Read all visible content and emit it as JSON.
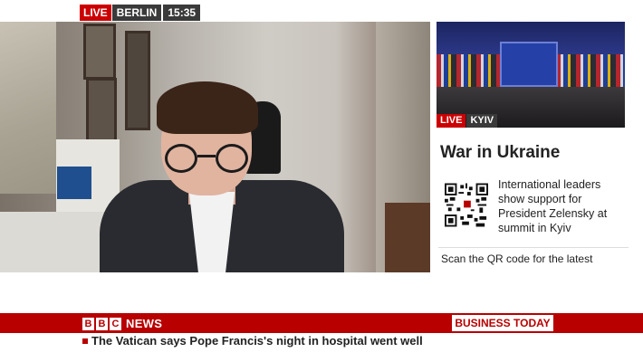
{
  "live_bug": {
    "live": "LIVE",
    "location": "BERLIN",
    "time": "15:35"
  },
  "side_panel": {
    "thumbnail": {
      "live": "LIVE",
      "location": "KYIV"
    },
    "title": "War in Ukraine",
    "qr_icon": "qr-code",
    "description": "International leaders show support for President Zelensky at summit in Kyiv",
    "scan_text": "Scan the QR code for the latest"
  },
  "lower_third": {
    "logo_letters": [
      "B",
      "B",
      "C"
    ],
    "logo_word": "NEWS",
    "program": "BUSINESS TODAY",
    "ticker": "The Vatican says Pope Francis's night in hospital went well"
  },
  "colors": {
    "bbc_red": "#b80000",
    "live_red": "#cc0000",
    "dark_grey": "#3a3a3a"
  }
}
